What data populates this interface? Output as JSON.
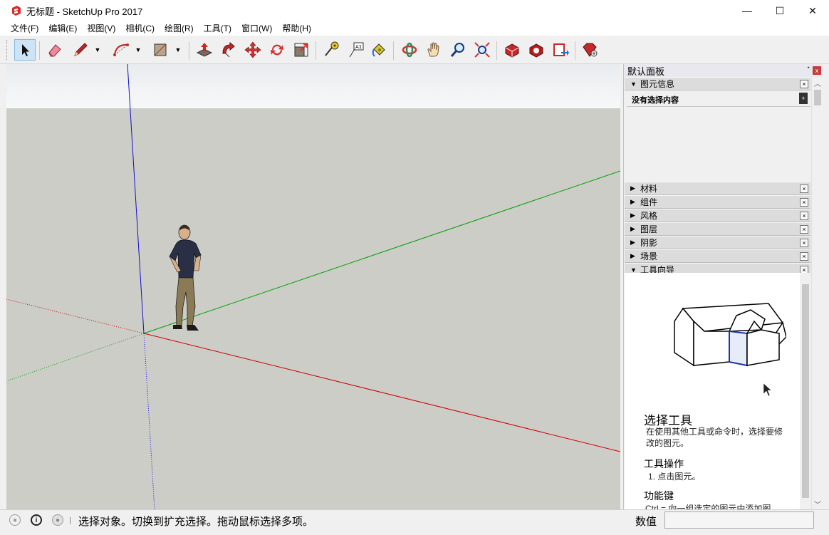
{
  "window": {
    "title": "无标题 - SketchUp Pro 2017",
    "minimize_glyph": "—",
    "maximize_glyph": "☐",
    "close_glyph": "✕"
  },
  "menu": [
    "文件(F)",
    "编辑(E)",
    "视图(V)",
    "相机(C)",
    "绘图(R)",
    "工具(T)",
    "窗口(W)",
    "帮助(H)"
  ],
  "toolbar": {
    "icons": [
      "select-icon",
      "eraser-icon",
      "pencil-icon",
      "arc-icon",
      "rectangle-icon",
      "push-pull-icon",
      "follow-me-icon",
      "move-icon",
      "rotate-icon",
      "scale-icon",
      "tape-measure-icon",
      "text-icon",
      "paint-bucket-icon",
      "orbit-icon",
      "pan-icon",
      "zoom-icon",
      "zoom-extents-icon",
      "3d-warehouse-icon",
      "extension-warehouse-icon",
      "layout-icon",
      "extension-manager-icon"
    ],
    "active_tool": "select"
  },
  "tray": {
    "title": "默认面板",
    "pin_glyph": "ᐩ",
    "close_glyph": "x",
    "entity_info": {
      "header": "图元信息",
      "empty_label": "没有选择内容"
    },
    "panels": [
      "材料",
      "组件",
      "风格",
      "图层",
      "阴影",
      "场景"
    ],
    "instructor": {
      "header": "工具向导",
      "title": "选择工具",
      "description": "在使用其他工具或命令时，选择要修改的图元。",
      "operations_heading": "工具操作",
      "operation_step": "1. 点击图元。",
      "keys_heading": "功能键",
      "keys_text": "Ctrl = 向一组选定的图元中添加图"
    }
  },
  "status": {
    "message": "选择对象。切换到扩充选择。拖动鼠标选择多项。",
    "value_label": "数值",
    "value": ""
  },
  "colors": {
    "sky": "#f1f3f4",
    "ground": "#cdcdc8",
    "axis_red": "#cc0000",
    "axis_green": "#00a000",
    "axis_blue": "#0000c8",
    "active_tool_bg": "#cde4f7"
  }
}
